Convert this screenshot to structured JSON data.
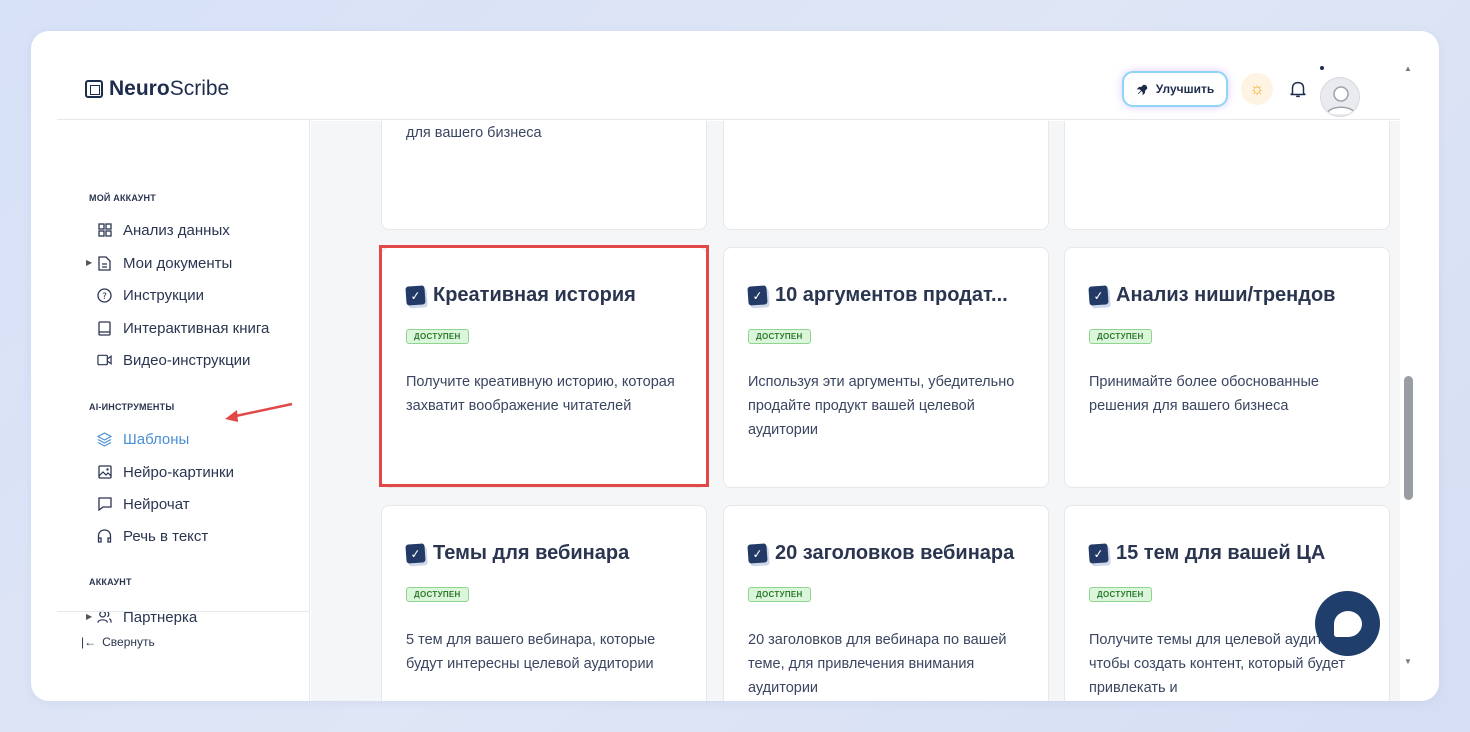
{
  "app": {
    "logo_bold": "Neuro",
    "logo_rest": "Scribe"
  },
  "header": {
    "upgrade_label": "Улучшить"
  },
  "sidebar": {
    "section_my_account": "МОЙ АККАУНТ",
    "items_my_account": [
      {
        "label": "Анализ данных",
        "icon": "grid-icon"
      },
      {
        "label": "Мои документы",
        "icon": "document-icon"
      },
      {
        "label": "Инструкции",
        "icon": "help-circle-icon"
      },
      {
        "label": "Интерактивная книга",
        "icon": "book-icon"
      },
      {
        "label": "Видео-инструкции",
        "icon": "video-icon"
      }
    ],
    "section_ai_tools": "AI-ИНСТРУМЕНТЫ",
    "items_ai_tools": [
      {
        "label": "Шаблоны",
        "icon": "layers-icon"
      },
      {
        "label": "Нейро-картинки",
        "icon": "image-icon"
      },
      {
        "label": "Нейрочат",
        "icon": "chat-icon"
      },
      {
        "label": "Речь в текст",
        "icon": "headphones-icon"
      }
    ],
    "section_account": "АККАУНТ",
    "items_account": [
      {
        "label": "Партнерка",
        "icon": "users-icon"
      }
    ],
    "collapse_label": "Свернуть"
  },
  "cards": {
    "top_row_partial_desc": "для вашего бизнеса",
    "badge": "ДОСТУПЕН",
    "row1": [
      {
        "title": "Креативная история",
        "desc": "Получите креативную историю, которая захватит воображение читателей"
      },
      {
        "title": "10 аргументов продат...",
        "desc": "Используя эти аргументы, убедительно продайте продукт вашей целевой аудитории"
      },
      {
        "title": "Анализ ниши/трендов",
        "desc": "Принимайте более обоснованные решения для вашего бизнеса"
      }
    ],
    "row2": [
      {
        "title": "Темы для вебинара",
        "desc": "5 тем для вашего вебинара, которые будут интересны целевой аудитории"
      },
      {
        "title": "20 заголовков вебинара",
        "desc": "20 заголовков для вебинара по вашей теме, для привлечения внимания аудитории"
      },
      {
        "title": "15 тем для вашей ЦА",
        "desc": "Получите темы для целевой аудитории, чтобы создать контент, который будет привлекать и"
      }
    ]
  },
  "colors": {
    "accent": "#4a8fd6",
    "highlight": "#e24848",
    "brand_dark": "#1f3e6b",
    "badge_bg": "#dcf6dc"
  }
}
